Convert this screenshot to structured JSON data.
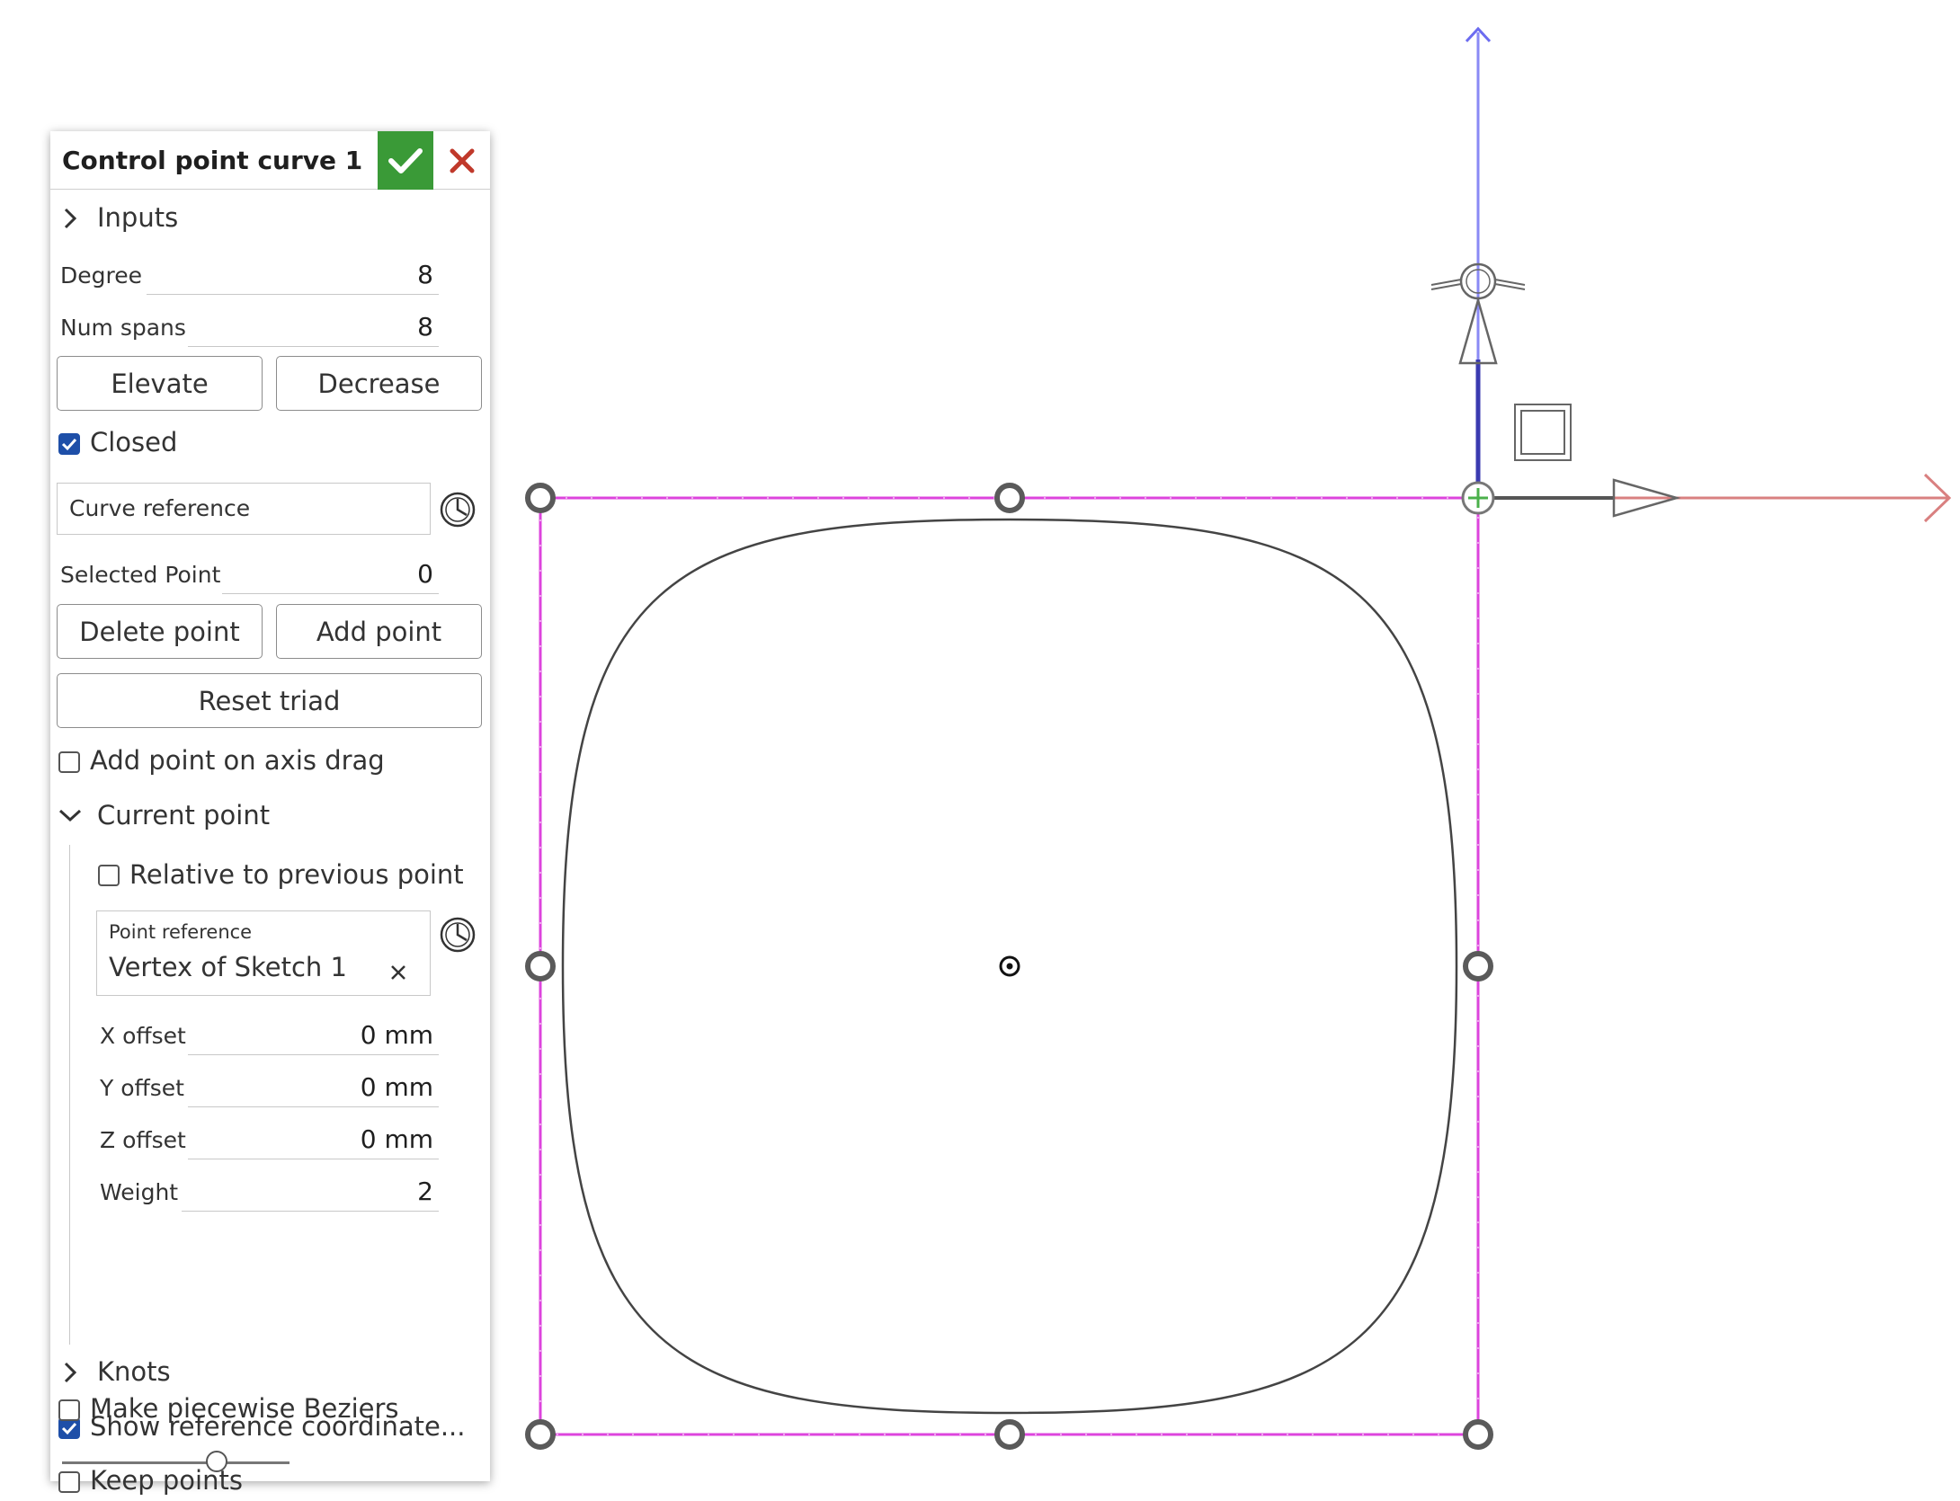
{
  "panel": {
    "title": "Control point curve 1",
    "inputs_section": "Inputs",
    "degree_label": "Degree",
    "degree_value": "8",
    "num_spans_label": "Num spans",
    "num_spans_value": "8",
    "elevate_button": "Elevate",
    "decrease_button": "Decrease",
    "closed_label": "Closed",
    "closed_checked": true,
    "curve_reference_placeholder": "Curve reference",
    "selected_point_label": "Selected Point",
    "selected_point_value": "0",
    "delete_point_button": "Delete point",
    "add_point_button": "Add point",
    "reset_triad_button": "Reset triad",
    "add_point_on_axis_drag_label": "Add point on axis drag",
    "add_point_on_axis_drag_checked": false,
    "current_point_section": "Current point",
    "relative_label": "Relative to previous point",
    "relative_checked": false,
    "point_reference_label": "Point reference",
    "point_reference_value": "Vertex of Sketch 1",
    "x_offset_label": "X offset",
    "x_offset_value": "0 mm",
    "y_offset_label": "Y offset",
    "y_offset_value": "0 mm",
    "z_offset_label": "Z offset",
    "z_offset_value": "0 mm",
    "weight_label": "Weight",
    "weight_value": "2",
    "knots_section": "Knots",
    "show_ref_coords_label": "Show reference coordinate...",
    "show_ref_coords_checked": true,
    "keep_points_label": "Keep points",
    "keep_points_checked": false,
    "piecewise_label": "Make piecewise Beziers",
    "piecewise_checked": false,
    "slider_value": 0.7
  },
  "colors": {
    "accept": "#3a9a37",
    "cancel": "#c0392b",
    "checkbox_on": "#1e4fa8",
    "control_polygon": "#dd44dd",
    "axis_z": "#6c6cf0",
    "axis_x": "#d98080",
    "curve": "#444444"
  }
}
